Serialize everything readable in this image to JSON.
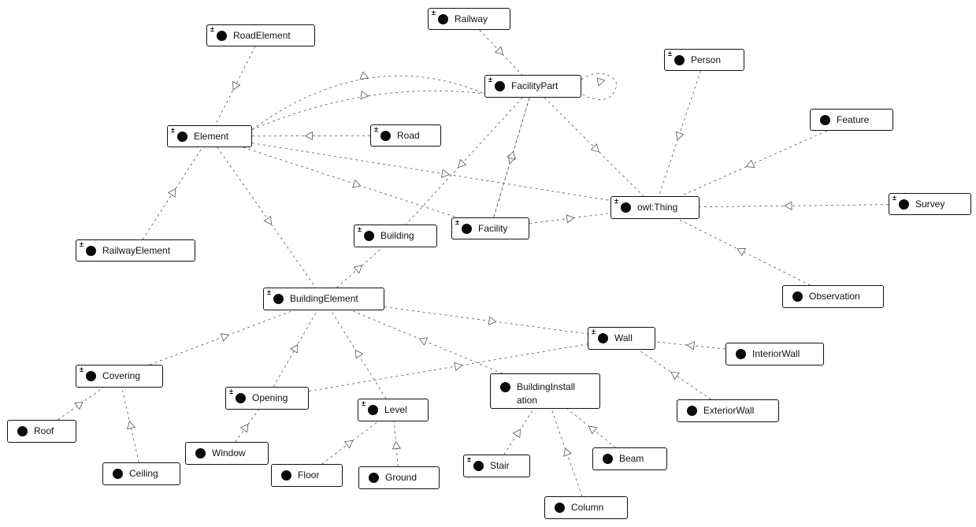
{
  "diagram": {
    "title": "",
    "type": "ontology-class-graph",
    "colors": {
      "node_border": "#111111",
      "node_fill": "#ffffff",
      "class_dot": "#0a0a0a",
      "edge": "#555555"
    },
    "nodes": [
      {
        "id": "RoadElement",
        "label": "RoadElement",
        "expandable": true
      },
      {
        "id": "Railway",
        "label": "Railway",
        "expandable": true
      },
      {
        "id": "FacilityPart",
        "label": "FacilityPart",
        "expandable": true
      },
      {
        "id": "Person",
        "label": "Person",
        "expandable": true
      },
      {
        "id": "Element",
        "label": "Element",
        "expandable": true
      },
      {
        "id": "Road",
        "label": "Road",
        "expandable": true
      },
      {
        "id": "Feature",
        "label": "Feature",
        "expandable": false
      },
      {
        "id": "owlThing",
        "label": "owl:Thing",
        "expandable": true
      },
      {
        "id": "Survey",
        "label": "Survey",
        "expandable": true
      },
      {
        "id": "RailwayElement",
        "label": "RailwayElement",
        "expandable": true
      },
      {
        "id": "Building",
        "label": "Building",
        "expandable": true
      },
      {
        "id": "Facility",
        "label": "Facility",
        "expandable": true
      },
      {
        "id": "Observation",
        "label": "Observation",
        "expandable": false
      },
      {
        "id": "BuildingElement",
        "label": "BuildingElement",
        "expandable": true
      },
      {
        "id": "Wall",
        "label": "Wall",
        "expandable": true
      },
      {
        "id": "InteriorWall",
        "label": "InteriorWall",
        "expandable": false
      },
      {
        "id": "Covering",
        "label": "Covering",
        "expandable": true
      },
      {
        "id": "Opening",
        "label": "Opening",
        "expandable": true
      },
      {
        "id": "Level",
        "label": "Level",
        "expandable": true
      },
      {
        "id": "BuildingInstallation",
        "label": "BuildingInstall\nation",
        "expandable": false
      },
      {
        "id": "ExteriorWall",
        "label": "ExteriorWall",
        "expandable": false
      },
      {
        "id": "Roof",
        "label": "Roof",
        "expandable": false
      },
      {
        "id": "Window",
        "label": "Window",
        "expandable": false
      },
      {
        "id": "Ceiling",
        "label": "Ceiling",
        "expandable": false
      },
      {
        "id": "Floor",
        "label": "Floor",
        "expandable": false
      },
      {
        "id": "Ground",
        "label": "Ground",
        "expandable": false
      },
      {
        "id": "Stair",
        "label": "Stair",
        "expandable": true
      },
      {
        "id": "Beam",
        "label": "Beam",
        "expandable": false
      },
      {
        "id": "Column",
        "label": "Column",
        "expandable": false
      }
    ],
    "edges": [
      {
        "from": "RoadElement",
        "to": "Element"
      },
      {
        "from": "Railway",
        "to": "FacilityPart"
      },
      {
        "from": "Element",
        "to": "FacilityPart"
      },
      {
        "from": "Element",
        "to": "FacilityPart",
        "variant": "second"
      },
      {
        "from": "FacilityPart",
        "to": "FacilityPart",
        "variant": "self-loop"
      },
      {
        "from": "Road",
        "to": "Element"
      },
      {
        "from": "Element",
        "to": "owlThing"
      },
      {
        "from": "Element",
        "to": "Facility"
      },
      {
        "from": "Element",
        "to": "BuildingElement"
      },
      {
        "from": "RailwayElement",
        "to": "Element"
      },
      {
        "from": "FacilityPart",
        "to": "owlThing"
      },
      {
        "from": "FacilityPart",
        "to": "Building"
      },
      {
        "from": "FacilityPart",
        "to": "Facility"
      },
      {
        "from": "Facility",
        "to": "FacilityPart"
      },
      {
        "from": "Person",
        "to": "owlThing"
      },
      {
        "from": "Feature",
        "to": "owlThing"
      },
      {
        "from": "Observation",
        "to": "owlThing"
      },
      {
        "from": "Facility",
        "to": "owlThing"
      },
      {
        "from": "Survey",
        "to": "owlThing"
      },
      {
        "from": "BuildingElement",
        "to": "Building"
      },
      {
        "from": "BuildingElement",
        "to": "Wall"
      },
      {
        "from": "Covering",
        "to": "BuildingElement"
      },
      {
        "from": "Opening",
        "to": "BuildingElement"
      },
      {
        "from": "Level",
        "to": "BuildingElement"
      },
      {
        "from": "BuildingInstallation",
        "to": "BuildingElement"
      },
      {
        "from": "Opening",
        "to": "Wall"
      },
      {
        "from": "InteriorWall",
        "to": "Wall"
      },
      {
        "from": "ExteriorWall",
        "to": "Wall"
      },
      {
        "from": "Roof",
        "to": "Covering"
      },
      {
        "from": "Ceiling",
        "to": "Covering"
      },
      {
        "from": "Window",
        "to": "Opening"
      },
      {
        "from": "Floor",
        "to": "Level"
      },
      {
        "from": "Ground",
        "to": "Level"
      },
      {
        "from": "Stair",
        "to": "BuildingInstallation"
      },
      {
        "from": "Column",
        "to": "BuildingInstallation"
      },
      {
        "from": "Beam",
        "to": "BuildingInstallation"
      }
    ]
  }
}
